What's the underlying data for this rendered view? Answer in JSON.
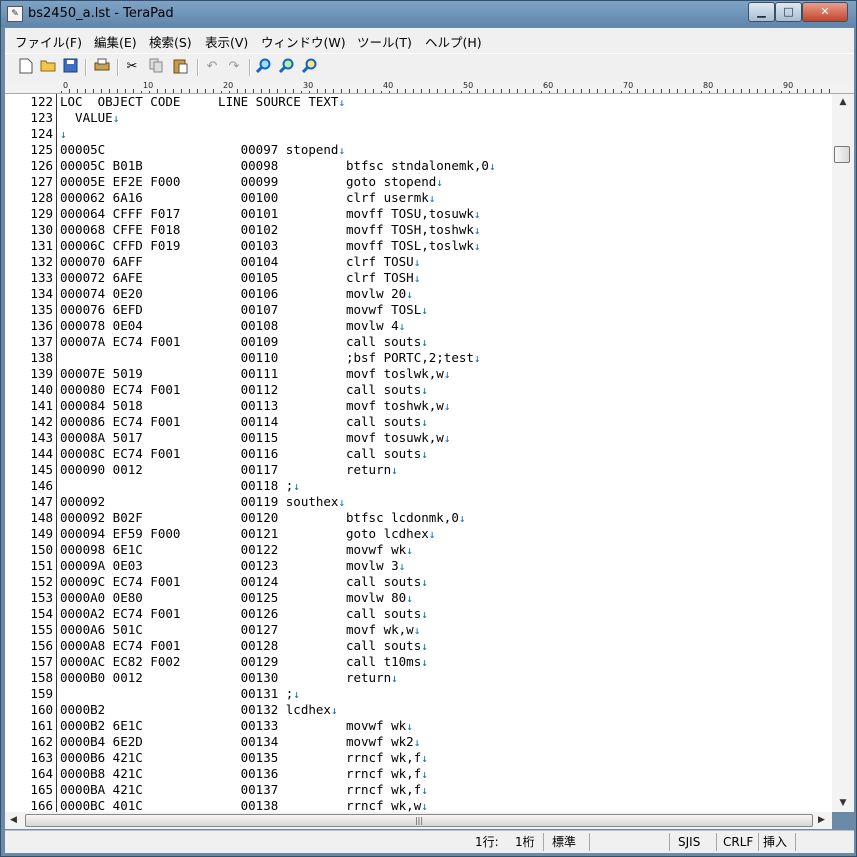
{
  "window": {
    "title": "bs2450_a.lst - TeraPad",
    "app_icon": "terapad-icon",
    "controls": [
      "minimize",
      "maximize",
      "close"
    ]
  },
  "menu": [
    "ファイル(F)",
    "編集(E)",
    "検索(S)",
    "表示(V)",
    "ウィンドウ(W)",
    "ツール(T)",
    "ヘルプ(H)"
  ],
  "toolbar": [
    "new-file-icon",
    "open-folder-icon",
    "save-icon",
    "print-icon",
    "cut-icon",
    "copy-icon",
    "paste-icon",
    "undo-icon",
    "redo-icon",
    "find-icon",
    "find-next-icon",
    "find-prev-icon"
  ],
  "ruler": {
    "labels": [
      "0",
      "10",
      "20",
      "30",
      "40",
      "50",
      "60",
      "70",
      "80",
      "90"
    ]
  },
  "editor": {
    "eol_mark": "↓",
    "lines": [
      {
        "n": "122",
        "text": "LOC  OBJECT CODE     LINE SOURCE TEXT",
        "eol": true
      },
      {
        "n": "123",
        "text": "  VALUE",
        "eol": true
      },
      {
        "n": "124",
        "text": "",
        "eol": true
      },
      {
        "n": "125",
        "text": "00005C                  00097 stopend",
        "eol": true
      },
      {
        "n": "126",
        "text": "00005C B01B             00098         btfsc stndalonemk,0",
        "eol": true
      },
      {
        "n": "127",
        "text": "00005E EF2E F000        00099         goto stopend",
        "eol": true
      },
      {
        "n": "128",
        "text": "000062 6A16             00100         clrf usermk",
        "eol": true
      },
      {
        "n": "129",
        "text": "000064 CFFF F017        00101         movff TOSU,tosuwk",
        "eol": true
      },
      {
        "n": "130",
        "text": "000068 CFFE F018        00102         movff TOSH,toshwk",
        "eol": true
      },
      {
        "n": "131",
        "text": "00006C CFFD F019        00103         movff TOSL,toslwk",
        "eol": true
      },
      {
        "n": "132",
        "text": "000070 6AFF             00104         clrf TOSU",
        "eol": true
      },
      {
        "n": "133",
        "text": "000072 6AFE             00105         clrf TOSH",
        "eol": true
      },
      {
        "n": "134",
        "text": "000074 0E20             00106         movlw 20",
        "eol": true
      },
      {
        "n": "135",
        "text": "000076 6EFD             00107         movwf TOSL",
        "eol": true
      },
      {
        "n": "136",
        "text": "000078 0E04             00108         movlw 4",
        "eol": true
      },
      {
        "n": "137",
        "text": "00007A EC74 F001        00109         call souts",
        "eol": true
      },
      {
        "n": "138",
        "text": "                        00110         ;bsf PORTC,2;test",
        "eol": true
      },
      {
        "n": "139",
        "text": "00007E 5019             00111         movf toslwk,w",
        "eol": true
      },
      {
        "n": "140",
        "text": "000080 EC74 F001        00112         call souts",
        "eol": true
      },
      {
        "n": "141",
        "text": "000084 5018             00113         movf toshwk,w",
        "eol": true
      },
      {
        "n": "142",
        "text": "000086 EC74 F001        00114         call souts",
        "eol": true
      },
      {
        "n": "143",
        "text": "00008A 5017             00115         movf tosuwk,w",
        "eol": true
      },
      {
        "n": "144",
        "text": "00008C EC74 F001        00116         call souts",
        "eol": true
      },
      {
        "n": "145",
        "text": "000090 0012             00117         return",
        "eol": true
      },
      {
        "n": "146",
        "text": "                        00118 ;",
        "eol": true
      },
      {
        "n": "147",
        "text": "000092                  00119 southex",
        "eol": true
      },
      {
        "n": "148",
        "text": "000092 B02F             00120         btfsc lcdonmk,0",
        "eol": true
      },
      {
        "n": "149",
        "text": "000094 EF59 F000        00121         goto lcdhex",
        "eol": true
      },
      {
        "n": "150",
        "text": "000098 6E1C             00122         movwf wk",
        "eol": true
      },
      {
        "n": "151",
        "text": "00009A 0E03             00123         movlw 3",
        "eol": true
      },
      {
        "n": "152",
        "text": "00009C EC74 F001        00124         call souts",
        "eol": true
      },
      {
        "n": "153",
        "text": "0000A0 0E80             00125         movlw 80",
        "eol": true
      },
      {
        "n": "154",
        "text": "0000A2 EC74 F001        00126         call souts",
        "eol": true
      },
      {
        "n": "155",
        "text": "0000A6 501C             00127         movf wk,w",
        "eol": true
      },
      {
        "n": "156",
        "text": "0000A8 EC74 F001        00128         call souts",
        "eol": true
      },
      {
        "n": "157",
        "text": "0000AC EC82 F002        00129         call t10ms",
        "eol": true
      },
      {
        "n": "158",
        "text": "0000B0 0012             00130         return",
        "eol": true
      },
      {
        "n": "159",
        "text": "                        00131 ;",
        "eol": true
      },
      {
        "n": "160",
        "text": "0000B2                  00132 lcdhex",
        "eol": true
      },
      {
        "n": "161",
        "text": "0000B2 6E1C             00133         movwf wk",
        "eol": true
      },
      {
        "n": "162",
        "text": "0000B4 6E2D             00134         movwf wk2",
        "eol": true
      },
      {
        "n": "163",
        "text": "0000B6 421C             00135         rrncf wk,f",
        "eol": true
      },
      {
        "n": "164",
        "text": "0000B8 421C             00136         rrncf wk,f",
        "eol": true
      },
      {
        "n": "165",
        "text": "0000BA 421C             00137         rrncf wk,f",
        "eol": true
      },
      {
        "n": "166",
        "text": "0000BC 401C             00138         rrncf wk,w",
        "eol": true
      }
    ]
  },
  "statusbar": {
    "row": "1行:",
    "col": "1桁",
    "mode": "標準",
    "encoding": "SJIS",
    "newline": "CRLF",
    "insert": "挿入"
  }
}
